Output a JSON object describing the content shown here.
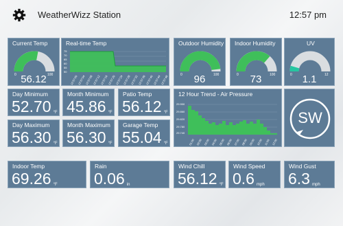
{
  "app": {
    "title": "WeatherWizz Station",
    "time": "12:57 pm"
  },
  "icons": {
    "settings": "gear-icon",
    "compass_arrow": "arrow-icon"
  },
  "colors": {
    "tile": "#5d7b96",
    "gauge_fill": "#3fbf5a",
    "gauge_track": "#d9dde0",
    "uv_fill": "#26c6a0"
  },
  "current_temp": {
    "label": "Current Temp",
    "value": "56.12",
    "min": "0",
    "max": "100",
    "level": 0.56
  },
  "realtime_temp": {
    "label": "Real-time Temp",
    "yticks": [
      "75",
      "70",
      "65",
      "60",
      "55",
      "50"
    ],
    "xticks": [
      "12:57:00",
      "12:57:04",
      "12:57:08",
      "12:57:12",
      "12:57:16",
      "12:57:20",
      "12:57:24",
      "12:57:28",
      "12:57:32",
      "12:57:36",
      "12:57:40",
      "12:57:44",
      "12:57:48"
    ]
  },
  "outdoor_humidity": {
    "label": "Outdoor Humidity",
    "value": "96",
    "min": "0",
    "max": "100",
    "level": 0.96
  },
  "indoor_humidity": {
    "label": "Indoor Humidity",
    "value": "73",
    "min": "0",
    "max": "100",
    "level": 0.73
  },
  "uv": {
    "label": "UV",
    "value": "1.1",
    "min": "0",
    "max": "12",
    "level": 0.09
  },
  "day_min": {
    "label": "Day Minimum",
    "value": "52.70",
    "unit": "°F"
  },
  "month_min": {
    "label": "Month Minimum",
    "value": "45.86",
    "unit": "°F"
  },
  "patio_temp": {
    "label": "Patio Temp",
    "value": "56.12",
    "unit": "°F"
  },
  "day_max": {
    "label": "Day Maximum",
    "value": "56.30",
    "unit": "°F"
  },
  "month_max": {
    "label": "Month Maximum",
    "value": "56.30",
    "unit": "°F"
  },
  "garage_temp": {
    "label": "Garage Temp",
    "value": "55.04",
    "unit": "°F"
  },
  "pressure": {
    "label": "12 Hour Trend - Air Pressure",
    "yticks": [
      "29.900",
      "29.860",
      "29.820",
      "29.780",
      "29.740"
    ],
    "xticks": [
      "01:00",
      "02:00",
      "03:00",
      "04:00",
      "05:00",
      "06:00",
      "07:00",
      "08:00",
      "09:00",
      "10:00",
      "11:00",
      "12:00"
    ]
  },
  "wind_dir": {
    "value": "SW"
  },
  "indoor_temp": {
    "label": "Indoor Temp",
    "value": "69.26",
    "unit": "°F"
  },
  "rain": {
    "label": "Rain",
    "value": "0.06",
    "unit": "in"
  },
  "wind_chill": {
    "label": "Wind Chill",
    "value": "56.12",
    "unit": "°F"
  },
  "wind_speed": {
    "label": "Wind Speed",
    "value": "0.6",
    "unit": "mph"
  },
  "wind_gust": {
    "label": "Wind Gust",
    "value": "6.3",
    "unit": "mph"
  }
}
